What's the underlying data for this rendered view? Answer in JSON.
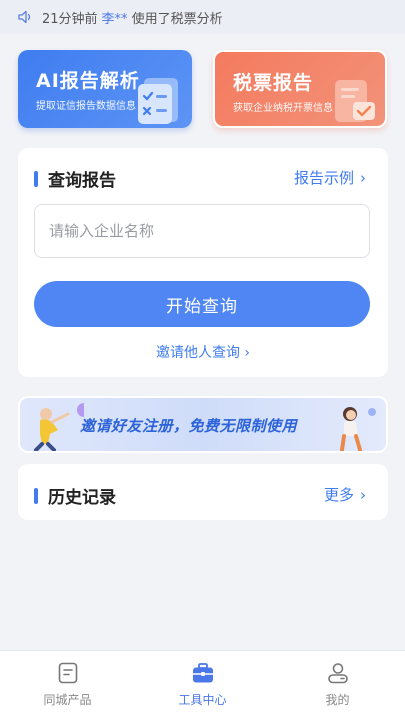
{
  "ticker": {
    "time": "21分钟前",
    "user": "李**",
    "action": "使用了税票分析"
  },
  "feature_cards": [
    {
      "title": "AI报告解析",
      "subtitle": "提取证信报告数据信息"
    },
    {
      "title": "税票报告",
      "subtitle": "获取企业纳税开票信息"
    }
  ],
  "query": {
    "title": "查询报告",
    "example_link": "报告示例",
    "placeholder": "请输入企业名称",
    "value": "",
    "submit_label": "开始查询",
    "invite_link": "邀请他人查询"
  },
  "banner": {
    "text": "邀请好友注册，免费无限制使用"
  },
  "history": {
    "title": "历史记录",
    "more_link": "更多"
  },
  "tabbar": {
    "items": [
      {
        "label": "同城产品",
        "icon": "document-icon",
        "active": false
      },
      {
        "label": "工具中心",
        "icon": "toolbox-icon",
        "active": true
      },
      {
        "label": "我的",
        "icon": "profile-icon",
        "active": false
      }
    ]
  },
  "colors": {
    "accent": "#4f86f3",
    "ai_card": "#3f7cf0",
    "tax_card": "#f47a5e",
    "page_bg": "#f2f3f7"
  }
}
